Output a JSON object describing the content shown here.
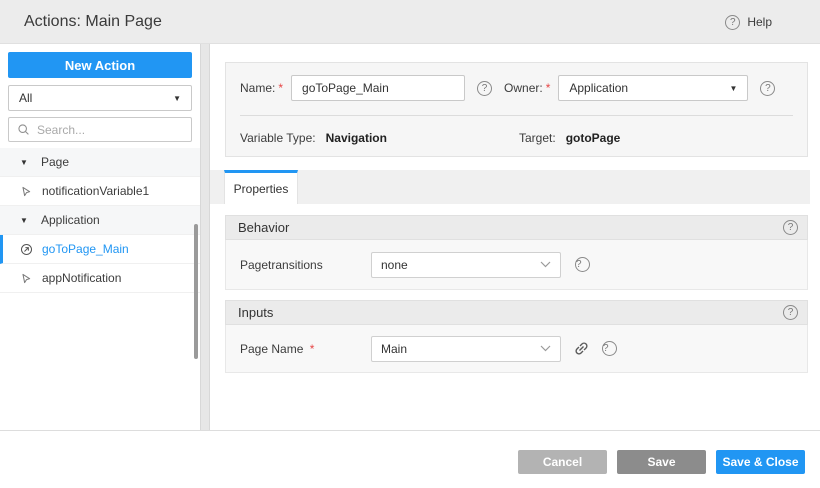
{
  "header": {
    "title": "Actions: Main Page",
    "help_label": "Help"
  },
  "sidebar": {
    "new_action_label": "New Action",
    "filter_value": "All",
    "search_placeholder": "Search...",
    "tree": [
      {
        "type": "group",
        "label": "Page"
      },
      {
        "type": "item",
        "label": "notificationVariable1",
        "icon": "variable-flag-icon",
        "selected": false
      },
      {
        "type": "group",
        "label": "Application"
      },
      {
        "type": "item",
        "label": "goToPage_Main",
        "icon": "navigation-icon",
        "selected": true
      },
      {
        "type": "item",
        "label": "appNotification",
        "icon": "variable-flag-icon",
        "selected": false
      }
    ]
  },
  "form": {
    "name_label": "Name:",
    "name_value": "goToPage_Main",
    "owner_label": "Owner:",
    "owner_value": "Application",
    "variable_type_label": "Variable Type:",
    "variable_type_value": "Navigation",
    "target_label": "Target:",
    "target_value": "gotoPage",
    "required_marker": "*"
  },
  "tabs": [
    {
      "label": "Properties",
      "active": true
    }
  ],
  "sections": [
    {
      "title": "Behavior",
      "fields": [
        {
          "label": "Pagetransitions",
          "value": "none",
          "required": false,
          "link": false
        }
      ]
    },
    {
      "title": "Inputs",
      "fields": [
        {
          "label": "Page Name",
          "value": "Main",
          "required": true,
          "link": true
        }
      ]
    }
  ],
  "footer": {
    "cancel_label": "Cancel",
    "save_label": "Save",
    "save_close_label": "Save & Close"
  },
  "icons": {
    "help_glyph": "?",
    "caret_glyph": "▼"
  },
  "colors": {
    "accent": "#2196f3",
    "cancel_gray": "#b3b3b3",
    "save_gray": "#8c8c8c"
  }
}
